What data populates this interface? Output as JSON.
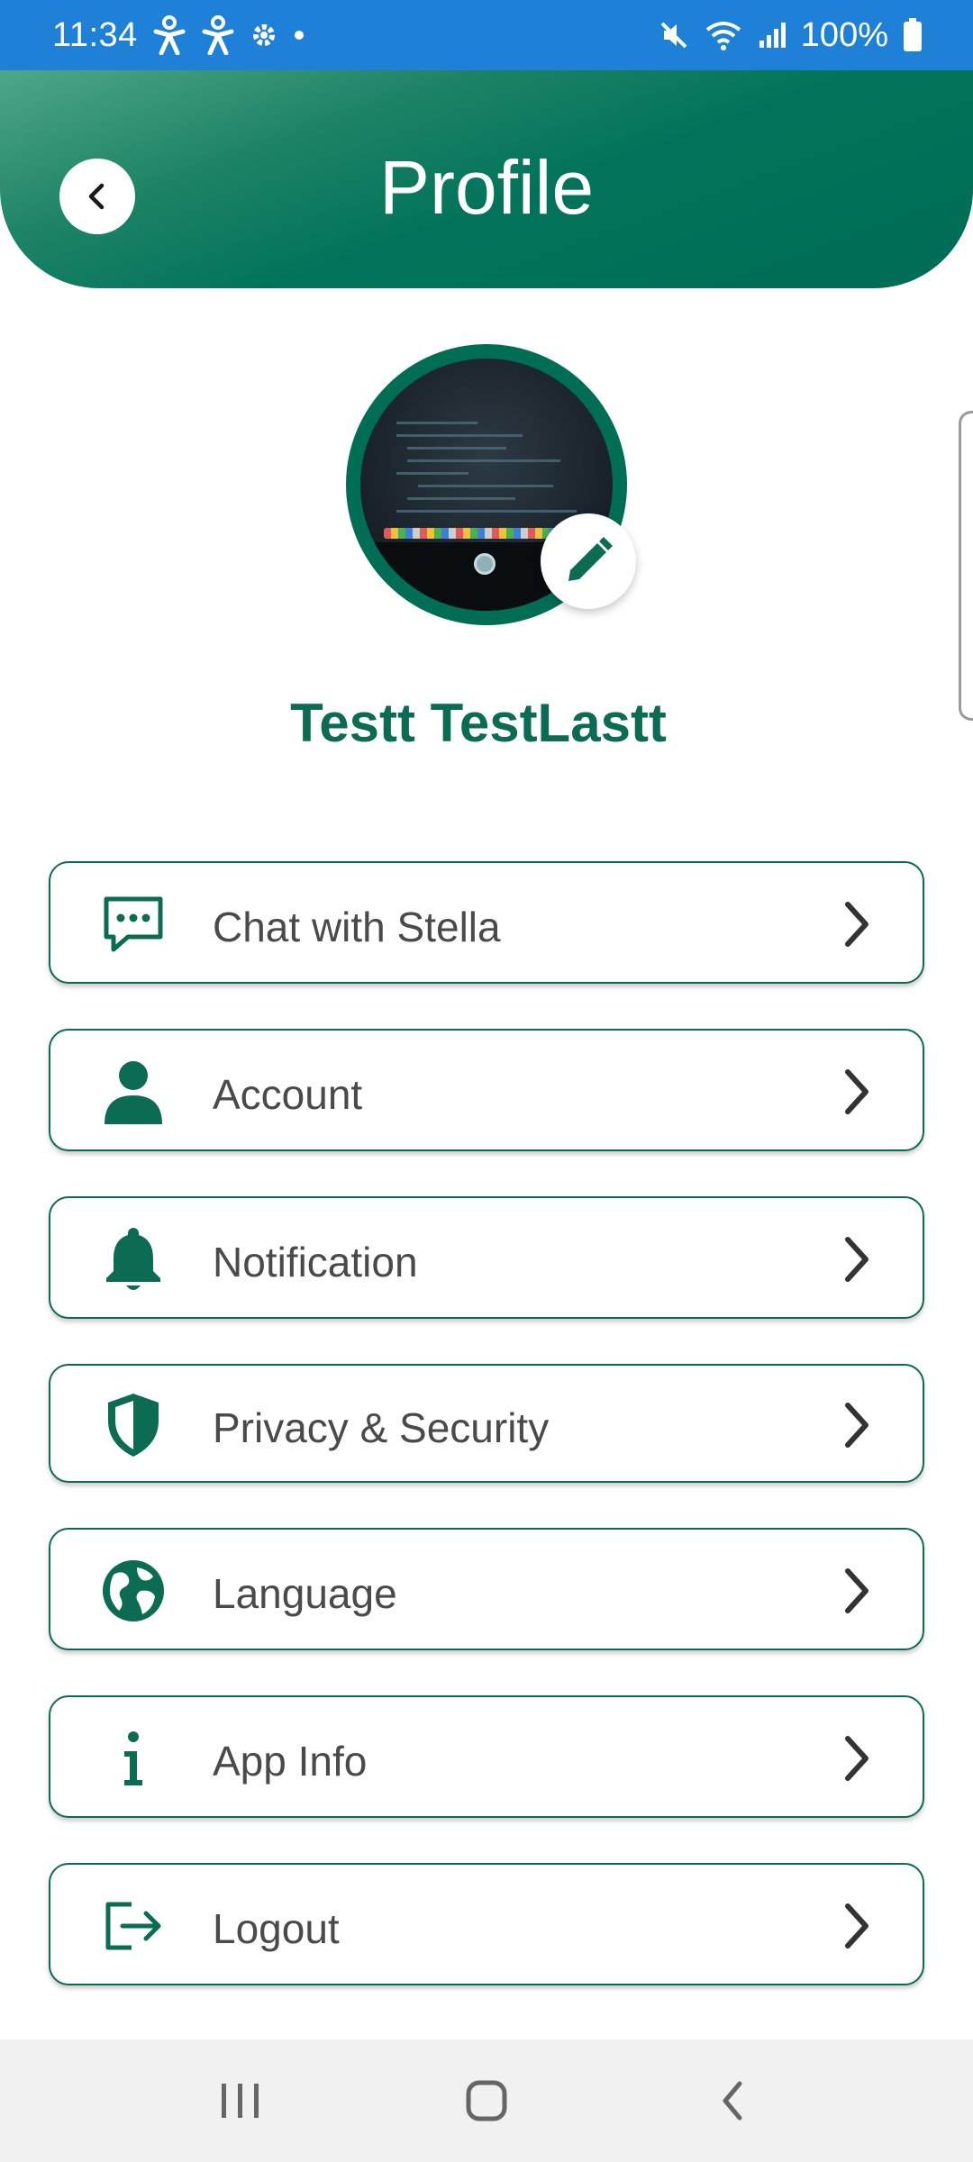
{
  "status_bar": {
    "time": "11:34",
    "battery": "100%",
    "icons": [
      "accessibility-icon",
      "accessibility-icon",
      "settings-icon",
      "dot-icon",
      "mute-icon",
      "wifi-icon",
      "signal-icon",
      "battery-icon"
    ]
  },
  "header": {
    "title": "Profile",
    "back_icon": "chevron-left-icon"
  },
  "profile": {
    "name": "Testt TestLastt",
    "edit_icon": "pencil-icon"
  },
  "menu": {
    "items": [
      {
        "label": "Chat with Stella",
        "icon": "chat-icon"
      },
      {
        "label": "Account",
        "icon": "person-icon"
      },
      {
        "label": "Notification",
        "icon": "bell-icon"
      },
      {
        "label": "Privacy & Security",
        "icon": "shield-icon"
      },
      {
        "label": "Language",
        "icon": "globe-icon"
      },
      {
        "label": "App Info",
        "icon": "info-icon"
      },
      {
        "label": "Logout",
        "icon": "logout-icon"
      }
    ]
  },
  "nav_bar": {
    "icons": [
      "recents-icon",
      "home-icon",
      "back-icon"
    ]
  },
  "colors": {
    "status_bar": "#1e80d6",
    "brand_green": "#006d55",
    "text_gray": "#4a4a4a",
    "nav_bar": "#f1f1f1"
  }
}
